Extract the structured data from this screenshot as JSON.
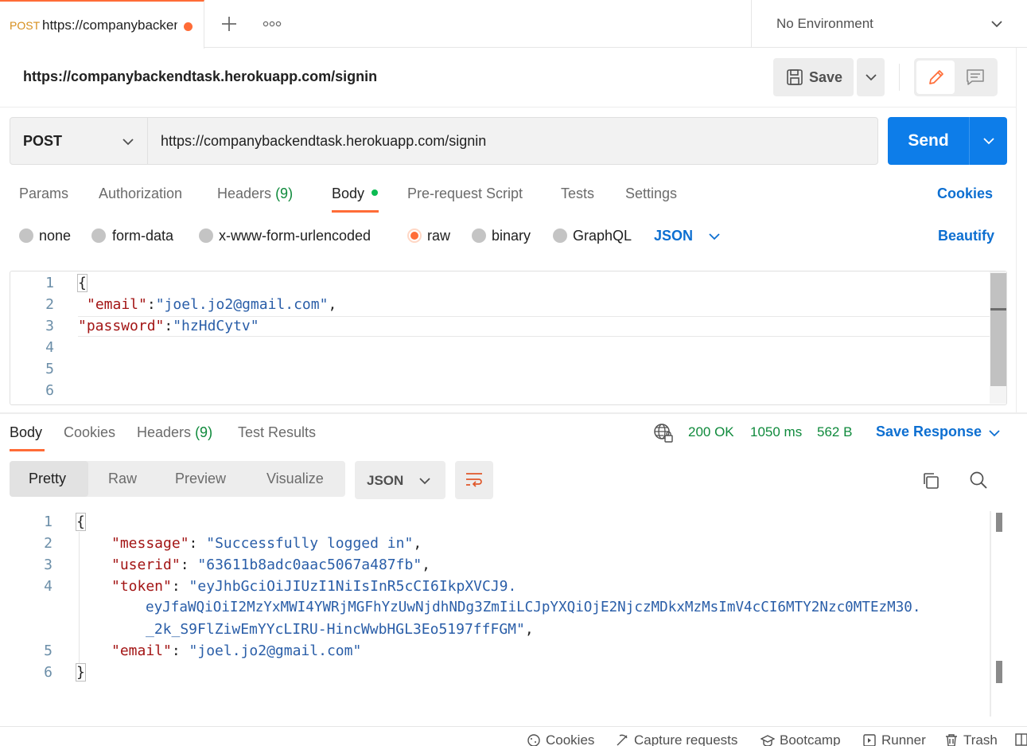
{
  "tab": {
    "method": "POST",
    "url": "https://companybackendtask.herokuapp.com/signin"
  },
  "environment": {
    "label": "No Environment"
  },
  "request": {
    "title": "https://companybackendtask.herokuapp.com/signin",
    "save_label": "Save",
    "method": "POST",
    "url": "https://companybackendtask.herokuapp.com/signin",
    "send_label": "Send",
    "tabs": {
      "params": "Params",
      "authorization": "Authorization",
      "headers": "Headers",
      "headers_count": "(9)",
      "body": "Body",
      "prerequest": "Pre-request Script",
      "tests": "Tests",
      "settings": "Settings"
    },
    "cookies_link": "Cookies",
    "body_types": {
      "none": "none",
      "form_data": "form-data",
      "urlencoded": "x-www-form-urlencoded",
      "raw": "raw",
      "binary": "binary",
      "graphql": "GraphQL"
    },
    "raw_format": "JSON",
    "beautify_label": "Beautify",
    "body_lines": {
      "l1": "{",
      "l2_key": "\"email\"",
      "l2_sep": ":",
      "l2_val": "\"joel.jo2@gmail.com\"",
      "l2_end": ",",
      "l3_key": "\"password\"",
      "l3_sep": ":",
      "l3_val": "\"hzHdCytv\""
    },
    "line_numbers": [
      "1",
      "2",
      "3",
      "4",
      "5",
      "6"
    ]
  },
  "response": {
    "tabs": {
      "body": "Body",
      "cookies": "Cookies",
      "headers": "Headers",
      "headers_count": "(9)",
      "test_results": "Test Results"
    },
    "status": "200 OK",
    "time": "1050 ms",
    "size": "562 B",
    "save_response_label": "Save Response",
    "views": {
      "pretty": "Pretty",
      "raw": "Raw",
      "preview": "Preview",
      "visualize": "Visualize"
    },
    "format": "JSON",
    "body_lines": {
      "open": "{",
      "message_key": "\"message\"",
      "message_val": "\"Successfully logged in\"",
      "userid_key": "\"userid\"",
      "userid_val": "\"63611b8adc0aac5067a487fb\"",
      "token_key": "\"token\"",
      "token_val_1": "\"eyJhbGciOiJIUzI1NiIsInR5cCI6IkpXVCJ9.",
      "token_val_2": "eyJfaWQiOiI2MzYxMWI4YWRjMGFhYzUwNjdhNDg3ZmIiLCJpYXQiOjE2NjczMDkxMzMsImV4cCI6MTY2Nzc0MTEzM30.",
      "token_val_3": "_2k_S9FlZiwEmYYcLIRU-HincWwbHGL3Eo5197ffFGM\"",
      "email_key": "\"email\"",
      "email_val": "\"joel.jo2@gmail.com\"",
      "close": "}"
    },
    "line_numbers": [
      "1",
      "2",
      "3",
      "4",
      "5",
      "6"
    ]
  },
  "footer": {
    "cookies": "Cookies",
    "capture": "Capture requests",
    "bootcamp": "Bootcamp",
    "runner": "Runner",
    "trash": "Trash"
  },
  "colors": {
    "accent": "#ff6c37",
    "primary": "#0d7de9",
    "link": "#0d6fd1",
    "success": "#0f8a3c"
  }
}
